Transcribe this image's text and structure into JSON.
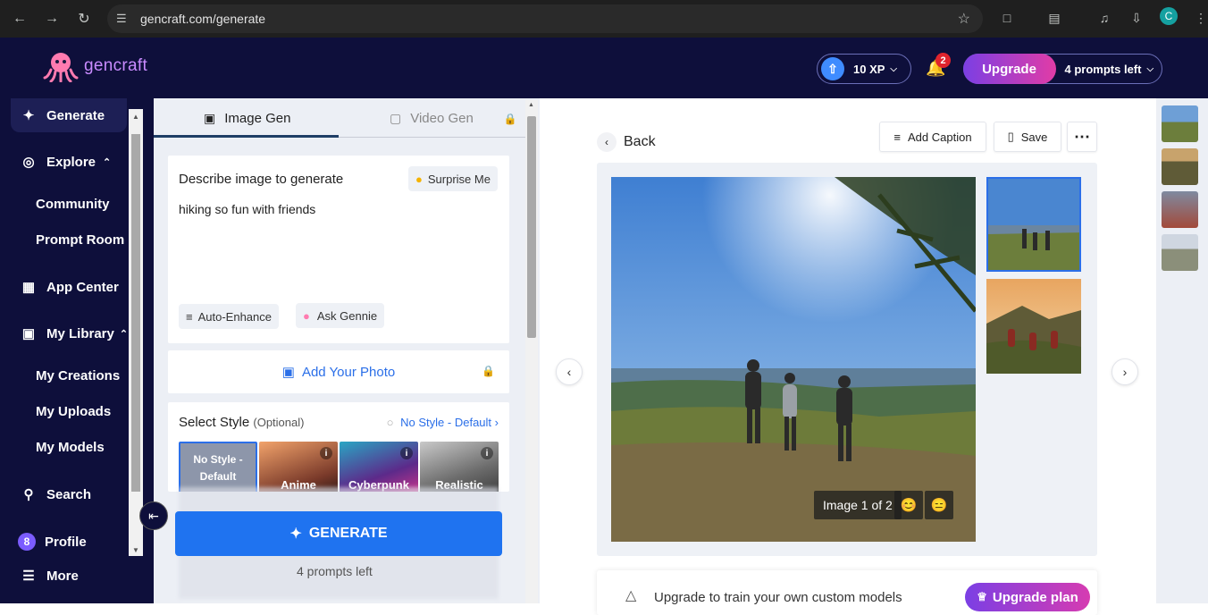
{
  "browser": {
    "url": "gencraft.com/generate",
    "avatar_letter": "C"
  },
  "header": {
    "logo_text": "gencraft",
    "xp_label": "10 XP",
    "notification_count": "2",
    "upgrade_label": "Upgrade",
    "prompts_left_label": "4 prompts left"
  },
  "sidebar": {
    "generate": "Generate",
    "explore": "Explore",
    "community": "Community",
    "prompt_room": "Prompt Room",
    "app_center": "App Center",
    "my_library": "My Library",
    "my_creations": "My Creations",
    "my_uploads": "My Uploads",
    "my_models": "My Models",
    "search": "Search",
    "profile": "Profile",
    "profile_badge": "8",
    "more": "More"
  },
  "panel": {
    "tab_image": "Image Gen",
    "tab_video": "Video Gen",
    "prompt_heading": "Describe image to generate",
    "surprise_label": "Surprise Me",
    "prompt_text": "hiking so fun with friends",
    "auto_enhance": "Auto-Enhance",
    "ask_gennie": "Ask Gennie",
    "add_photo": "Add Your Photo",
    "select_style": "Select Style",
    "optional": "(Optional)",
    "style_link": "No Style - Default",
    "styles": [
      {
        "label": "No Style - Default"
      },
      {
        "label": "Anime"
      },
      {
        "label": "Cyberpunk"
      },
      {
        "label": "Realistic"
      }
    ],
    "generate_label": "GENERATE",
    "prompts_left": "4 prompts left"
  },
  "main": {
    "back_label": "Back",
    "add_caption": "Add Caption",
    "save": "Save",
    "image_counter": "Image 1 of 2",
    "promo_text": "Upgrade to train your own custom models",
    "promo_button": "Upgrade plan"
  }
}
